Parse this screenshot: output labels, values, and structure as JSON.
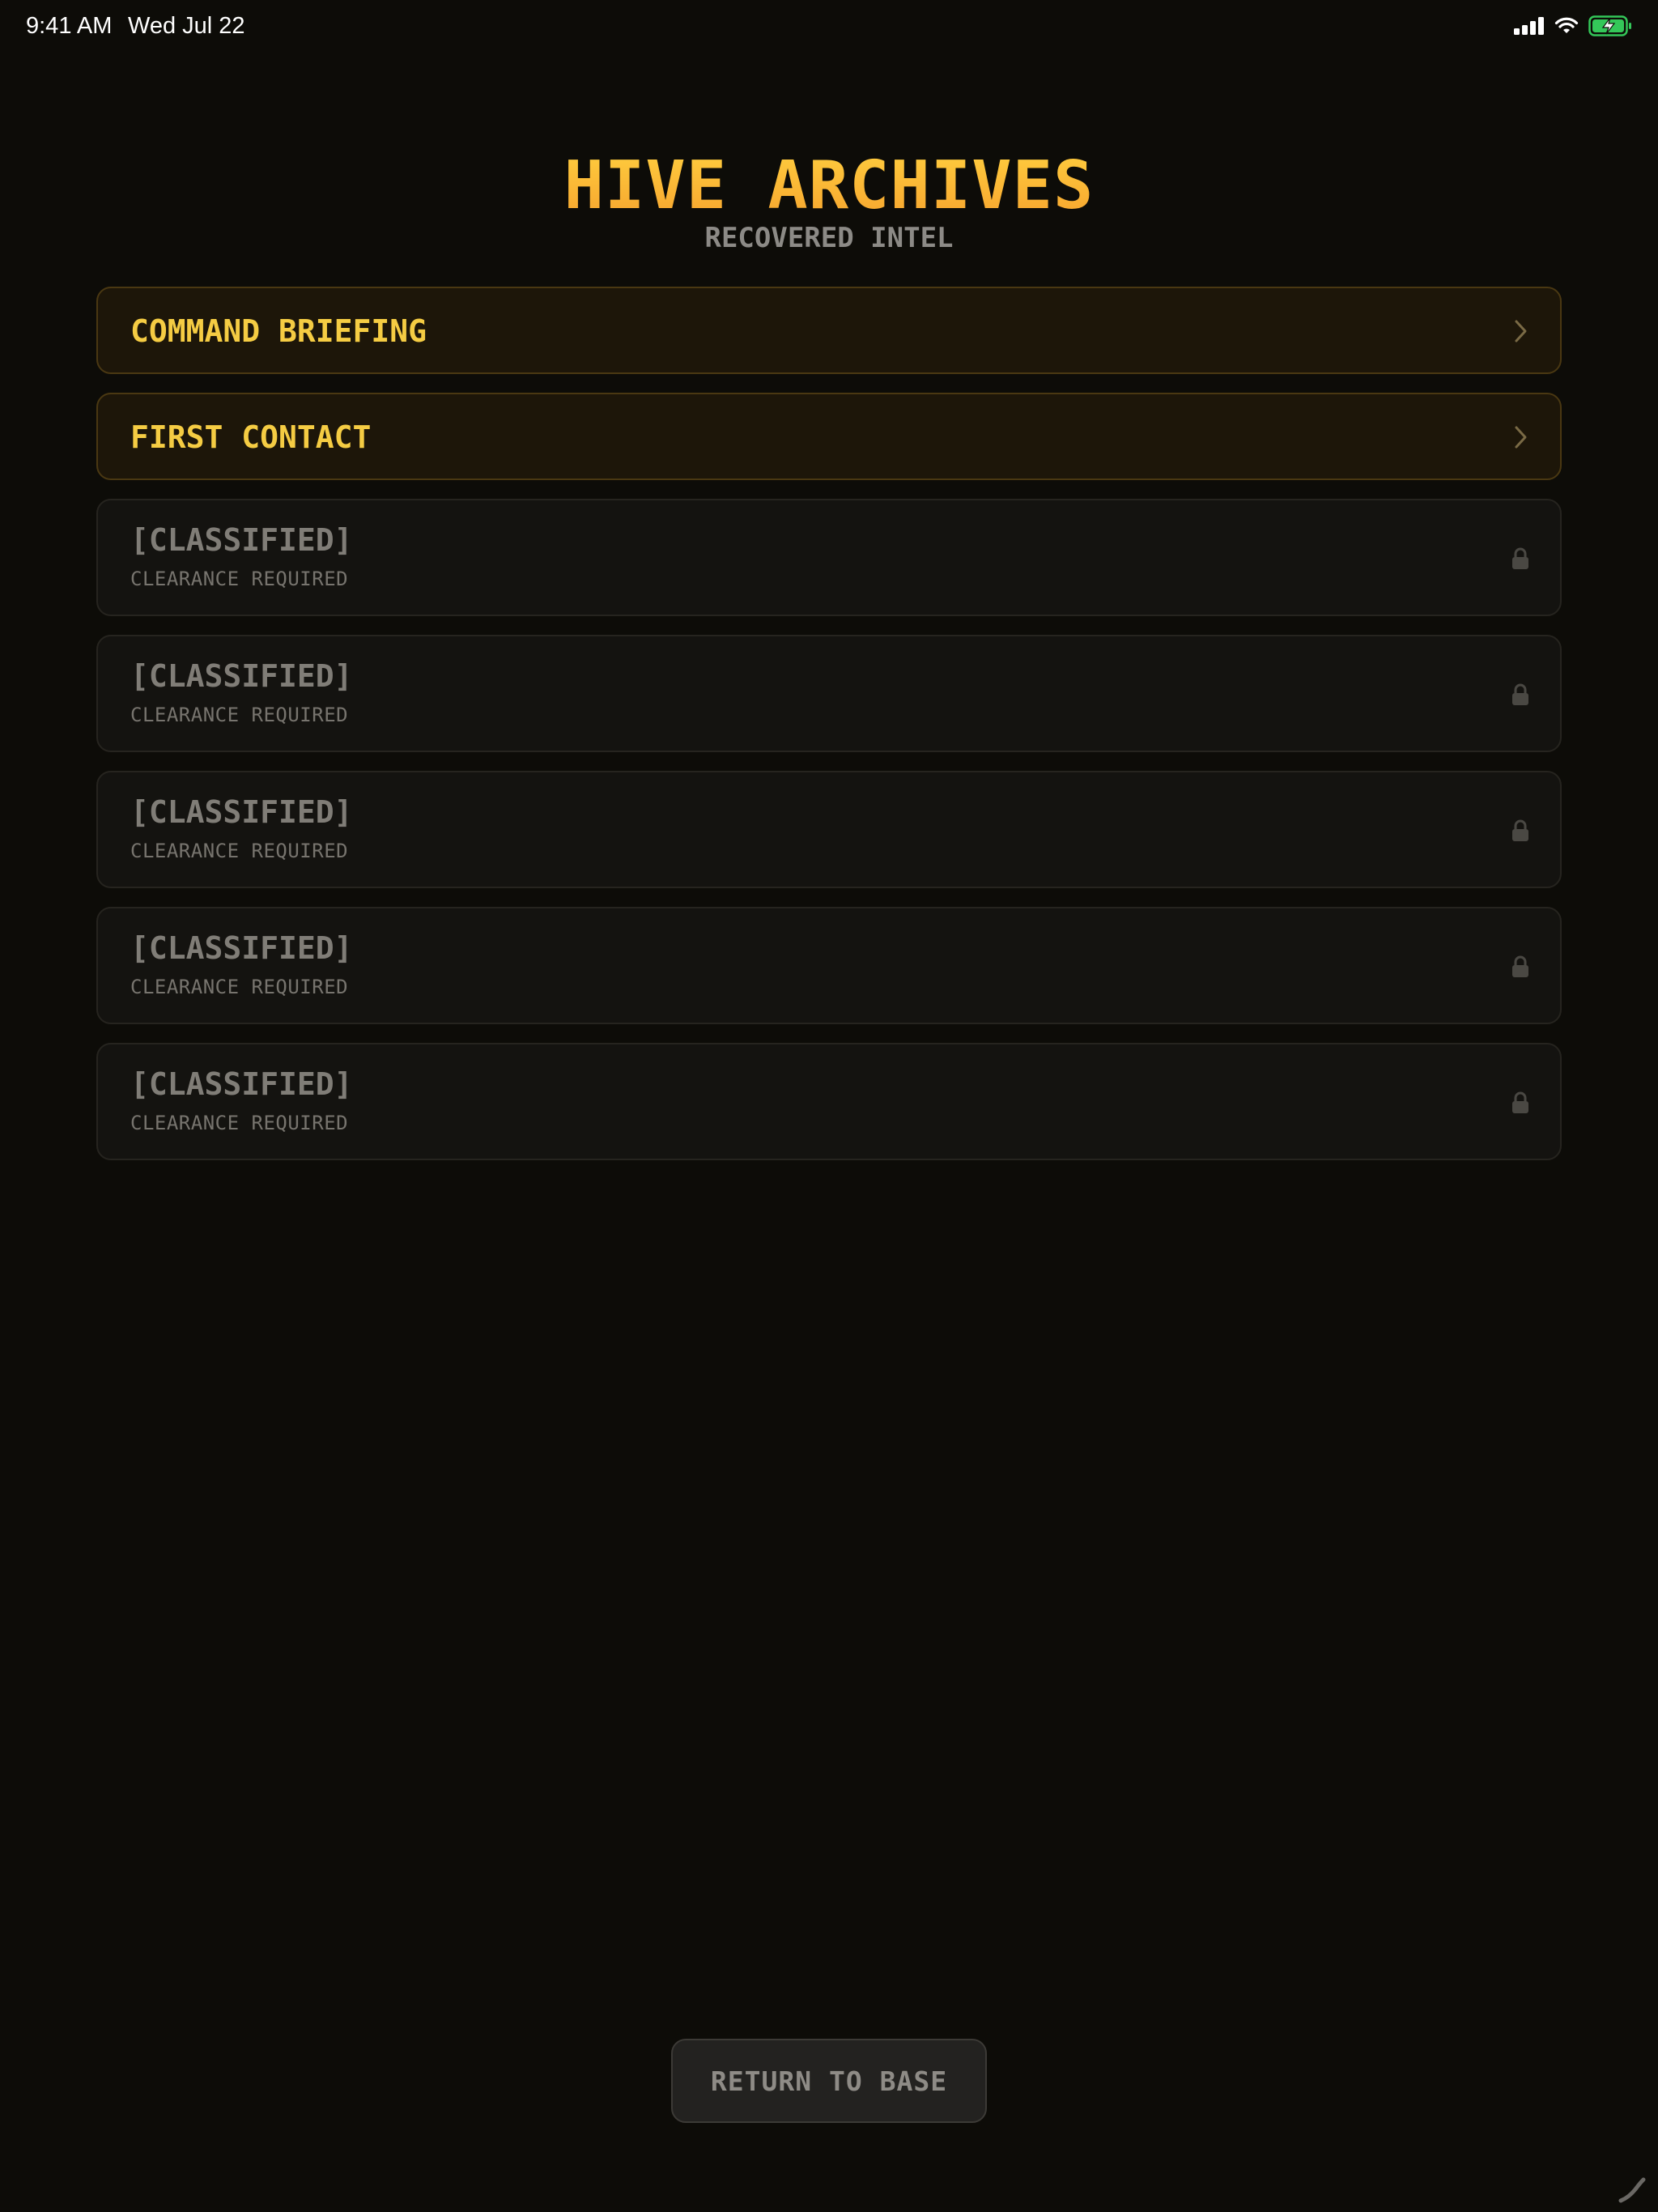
{
  "status_bar": {
    "time": "9:41 AM",
    "date": "Wed Jul 22",
    "icons": [
      "cellular-signal-icon",
      "wifi-icon",
      "battery-charging-icon"
    ]
  },
  "header": {
    "title": "HIVE ARCHIVES",
    "subtitle": "RECOVERED INTEL"
  },
  "archive_items": [
    {
      "label": "COMMAND BRIEFING",
      "locked": false,
      "icon": "chevron-right-icon"
    },
    {
      "label": "FIRST CONTACT",
      "locked": false,
      "icon": "chevron-right-icon"
    },
    {
      "label": "[CLASSIFIED]",
      "sublabel": "CLEARANCE REQUIRED",
      "locked": true,
      "icon": "lock-icon"
    },
    {
      "label": "[CLASSIFIED]",
      "sublabel": "CLEARANCE REQUIRED",
      "locked": true,
      "icon": "lock-icon"
    },
    {
      "label": "[CLASSIFIED]",
      "sublabel": "CLEARANCE REQUIRED",
      "locked": true,
      "icon": "lock-icon"
    },
    {
      "label": "[CLASSIFIED]",
      "sublabel": "CLEARANCE REQUIRED",
      "locked": true,
      "icon": "lock-icon"
    },
    {
      "label": "[CLASSIFIED]",
      "sublabel": "CLEARANCE REQUIRED",
      "locked": true,
      "icon": "lock-icon"
    }
  ],
  "footer": {
    "return_label": "RETURN TO BASE"
  },
  "colors": {
    "background": "#0d0c08",
    "accent_gold": "#f5cc43",
    "title_orange": "#f9b233",
    "muted_text": "#807d77",
    "battery_green": "#34c759"
  }
}
